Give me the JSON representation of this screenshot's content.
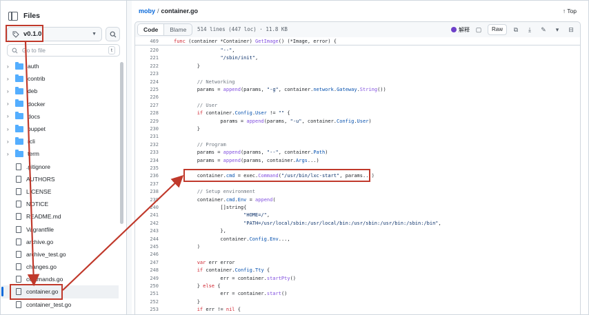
{
  "sidebar": {
    "title": "Files",
    "branch": "v0.1.0",
    "goto_placeholder": "Go to file",
    "goto_shortcut": "t",
    "items": [
      {
        "name": "auth",
        "type": "folder"
      },
      {
        "name": "contrib",
        "type": "folder"
      },
      {
        "name": "deb",
        "type": "folder"
      },
      {
        "name": "docker",
        "type": "folder"
      },
      {
        "name": "docs",
        "type": "folder"
      },
      {
        "name": "puppet",
        "type": "folder"
      },
      {
        "name": "rcli",
        "type": "folder"
      },
      {
        "name": "term",
        "type": "folder"
      },
      {
        "name": ".gitignore",
        "type": "file"
      },
      {
        "name": "AUTHORS",
        "type": "file"
      },
      {
        "name": "LICENSE",
        "type": "file"
      },
      {
        "name": "NOTICE",
        "type": "file"
      },
      {
        "name": "README.md",
        "type": "file"
      },
      {
        "name": "Vagrantfile",
        "type": "file"
      },
      {
        "name": "archive.go",
        "type": "file"
      },
      {
        "name": "archive_test.go",
        "type": "file"
      },
      {
        "name": "changes.go",
        "type": "file"
      },
      {
        "name": "commands.go",
        "type": "file"
      },
      {
        "name": "container.go",
        "type": "file",
        "selected": true
      },
      {
        "name": "container_test.go",
        "type": "file"
      }
    ]
  },
  "header": {
    "repo": "moby",
    "separator": "/",
    "file": "container.go",
    "top_link": "Top"
  },
  "toolbar": {
    "code_tab": "Code",
    "blame_tab": "Blame",
    "meta": "514 lines (447 loc) · 11.8 KB",
    "explain_label": "解释",
    "raw_label": "Raw"
  },
  "code": {
    "sticky": {
      "num": "469",
      "text": "func (container *Container) GetImage() (*Image, error) {"
    },
    "lines": [
      {
        "num": "220",
        "html": "                \"--\","
      },
      {
        "num": "221",
        "html": "                \"/sbin/init\","
      },
      {
        "num": "222",
        "html": "        }"
      },
      {
        "num": "223",
        "html": ""
      },
      {
        "num": "224",
        "html": "        // Networking"
      },
      {
        "num": "225",
        "html": "        params = append(params, \"-g\", container.network.Gateway.String())"
      },
      {
        "num": "226",
        "html": ""
      },
      {
        "num": "227",
        "html": "        // User"
      },
      {
        "num": "228",
        "html": "        if container.Config.User != \"\" {"
      },
      {
        "num": "229",
        "html": "                params = append(params, \"-u\", container.Config.User)"
      },
      {
        "num": "230",
        "html": "        }"
      },
      {
        "num": "231",
        "html": ""
      },
      {
        "num": "232",
        "html": "        // Program"
      },
      {
        "num": "233",
        "html": "        params = append(params, \"--\", container.Path)"
      },
      {
        "num": "234",
        "html": "        params = append(params, container.Args...)"
      },
      {
        "num": "235",
        "html": ""
      },
      {
        "num": "236",
        "html": "        container.cmd = exec.Command(\"/usr/bin/lxc-start\", params...)"
      },
      {
        "num": "237",
        "html": ""
      },
      {
        "num": "238",
        "html": "        // Setup environment"
      },
      {
        "num": "239",
        "html": "        container.cmd.Env = append("
      },
      {
        "num": "240",
        "html": "                []string{"
      },
      {
        "num": "241",
        "html": "                        \"HOME=/\","
      },
      {
        "num": "242",
        "html": "                        \"PATH=/usr/local/sbin:/usr/local/bin:/usr/sbin:/usr/bin:/sbin:/bin\","
      },
      {
        "num": "243",
        "html": "                },"
      },
      {
        "num": "244",
        "html": "                container.Config.Env...,"
      },
      {
        "num": "245",
        "html": "        )"
      },
      {
        "num": "246",
        "html": ""
      },
      {
        "num": "247",
        "html": "        var err error"
      },
      {
        "num": "248",
        "html": "        if container.Config.Tty {"
      },
      {
        "num": "249",
        "html": "                err = container.startPty()"
      },
      {
        "num": "250",
        "html": "        } else {"
      },
      {
        "num": "251",
        "html": "                err = container.start()"
      },
      {
        "num": "252",
        "html": "        }"
      },
      {
        "num": "253",
        "html": "        if err != nil {"
      }
    ]
  },
  "colors": {
    "annotation": "#c0392b",
    "link": "#0969da",
    "keyword": "#cf222e",
    "function": "#8250df",
    "string": "#0a3069",
    "comment": "#6e7781"
  }
}
